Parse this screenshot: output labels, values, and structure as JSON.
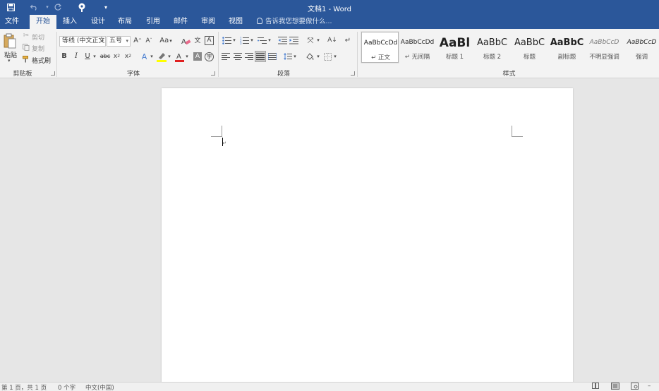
{
  "window": {
    "title": "文档1 - Word"
  },
  "quick_access": {
    "save": "save-icon",
    "undo": "undo-icon",
    "redo": "redo-icon",
    "touch": "touch-mode-icon",
    "customize": "customize-qat-icon"
  },
  "tabs": [
    {
      "label": "文件"
    },
    {
      "label": "开始"
    },
    {
      "label": "插入"
    },
    {
      "label": "设计"
    },
    {
      "label": "布局"
    },
    {
      "label": "引用"
    },
    {
      "label": "邮件"
    },
    {
      "label": "审阅"
    },
    {
      "label": "视图"
    }
  ],
  "tell_me": {
    "placeholder": "告诉我您想要做什么..."
  },
  "clipboard": {
    "paste": "粘贴",
    "cut": "剪切",
    "copy": "复制",
    "format_painter": "格式刷",
    "group_label": "剪贴板"
  },
  "font": {
    "font_name": "等线 (中文正文)",
    "font_size": "五号",
    "group_label": "字体",
    "change_case": "Aa"
  },
  "paragraph": {
    "group_label": "段落"
  },
  "styles": {
    "group_label": "样式",
    "items": [
      {
        "sample": "AaBbCcDd",
        "label": "正文"
      },
      {
        "sample": "AaBbCcDd",
        "label": "无间隔"
      },
      {
        "sample": "AaBl",
        "label": "标题 1"
      },
      {
        "sample": "AaBbC",
        "label": "标题 2"
      },
      {
        "sample": "AaBbC",
        "label": "标题"
      },
      {
        "sample": "AaBbC",
        "label": "副标题"
      },
      {
        "sample": "AaBbCcD",
        "label": "不明显强调"
      },
      {
        "sample": "AaBbCcD",
        "label": "强调"
      }
    ]
  },
  "status": {
    "page": "第 1 页，共 1 页",
    "words": "0 个字",
    "language": "中文(中国)"
  },
  "colors": {
    "brand": "#2b579a",
    "ribbon": "#f3f3f3",
    "canvas": "#e6e6e6",
    "highlight": "#ffff00",
    "font_color": "#e02020"
  }
}
